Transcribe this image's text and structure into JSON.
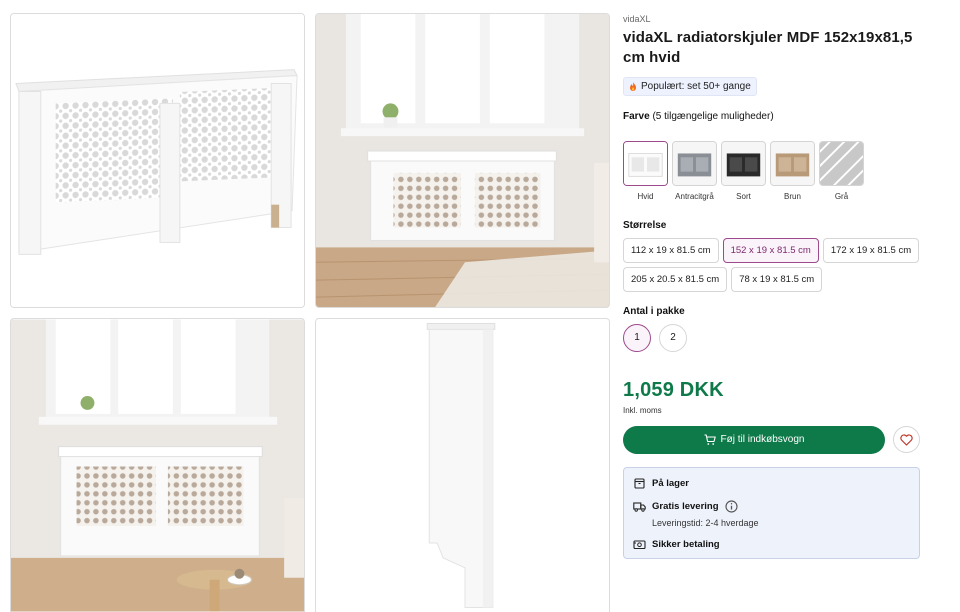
{
  "product": {
    "brand": "vidaXL",
    "title": "vidaXL radiatorskjuler MDF 152x19x81,5 cm hvid",
    "popular_badge": "Populært: set 50+ gange"
  },
  "color": {
    "label": "Farve",
    "options_note": "(5 tilgængelige muligheder)",
    "options": [
      {
        "name": "Hvid",
        "selected": true,
        "color": "#ffffff"
      },
      {
        "name": "Antracitgrå",
        "selected": false,
        "color": "#8a8f96"
      },
      {
        "name": "Sort",
        "selected": false,
        "color": "#2a2a2a"
      },
      {
        "name": "Brun",
        "selected": false,
        "color": "#b89a78"
      },
      {
        "name": "Grå",
        "selected": false,
        "color": "#c8c8c8"
      }
    ]
  },
  "size": {
    "label": "Størrelse",
    "options": [
      {
        "name": "112 x 19 x 81.5 cm",
        "selected": false
      },
      {
        "name": "152 x 19 x 81.5 cm",
        "selected": true
      },
      {
        "name": "172 x 19 x 81.5 cm",
        "selected": false
      },
      {
        "name": "205 x 20.5 x 81.5 cm",
        "selected": false
      },
      {
        "name": "78 x 19 x 81.5 cm",
        "selected": false
      }
    ]
  },
  "quantity": {
    "label": "Antal i pakke",
    "options": [
      {
        "name": "1",
        "selected": true
      },
      {
        "name": "2",
        "selected": false
      }
    ]
  },
  "price": {
    "amount": "1,059 DKK",
    "vat_note": "Inkl. moms"
  },
  "actions": {
    "cart_label": "Føj til indkøbsvogn"
  },
  "delivery": {
    "stock": "På lager",
    "free_delivery": "Gratis levering",
    "delivery_time": "Leveringstid: 2-4 hverdage",
    "secure_payment": "Sikker betaling"
  },
  "colors": {
    "accent_green": "#0e7a4a",
    "selected_border": "#9c4a8c",
    "info_box_bg": "#eef2fb"
  }
}
